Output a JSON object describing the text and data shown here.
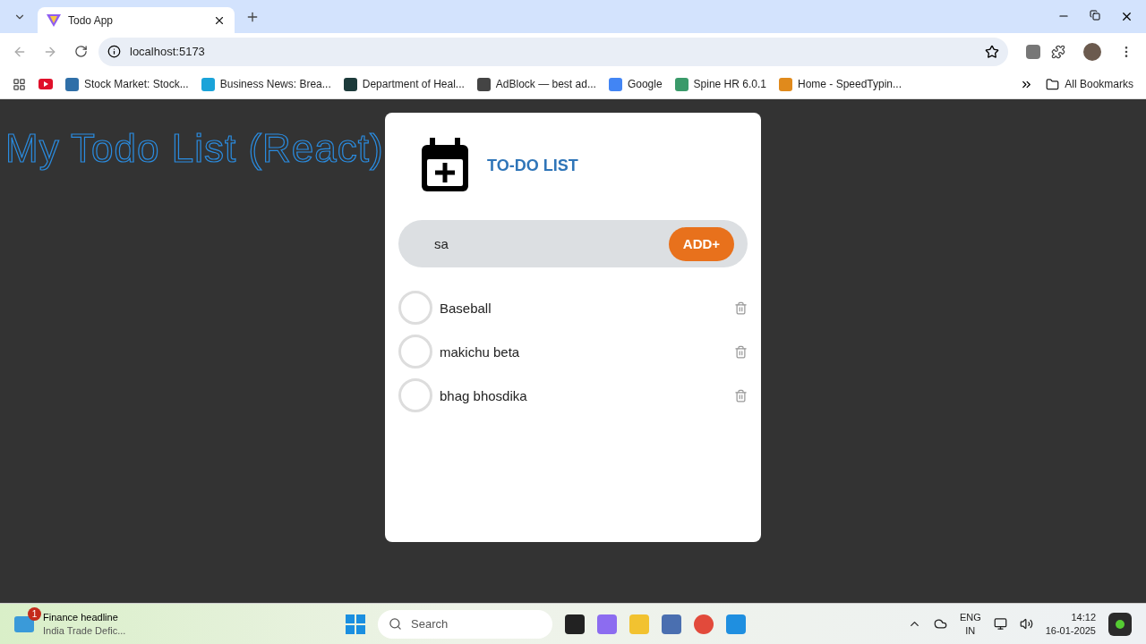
{
  "browser": {
    "tabs": [
      {
        "title": "Todo App",
        "selected": true
      }
    ],
    "address": "localhost:5173",
    "bookmarks": [
      {
        "label": "Stock Market: Stock...",
        "color": "#2f6fa8"
      },
      {
        "label": "Business News: Brea...",
        "color": "#1aa3d9"
      },
      {
        "label": "Department of Heal...",
        "color": "#1d3b3b"
      },
      {
        "label": "AdBlock — best ad...",
        "color": "#444444"
      },
      {
        "label": "Google",
        "color": "#4285f4"
      },
      {
        "label": "Spine HR 6.0.1",
        "color": "#3a9a6a"
      },
      {
        "label": "Home - SpeedTypin...",
        "color": "#e08a1c"
      }
    ],
    "all_bookmarks": "All Bookmarks"
  },
  "page": {
    "heading": "My Todo List (React)",
    "card": {
      "title": "TO-DO LIST",
      "input": {
        "value": "sa"
      },
      "add_button": "ADD+",
      "todos": [
        {
          "text": "Baseball",
          "done": false
        },
        {
          "text": "makichu beta",
          "done": false
        },
        {
          "text": "bhag bhosdika",
          "done": false
        }
      ]
    }
  },
  "taskbar": {
    "news": {
      "badge": "1",
      "title": "Finance headline",
      "subtitle": "India Trade Defic..."
    },
    "search": {
      "placeholder": "Search"
    },
    "language": "ENG",
    "region": "IN",
    "time": "14:12",
    "date": "16-01-2025"
  }
}
